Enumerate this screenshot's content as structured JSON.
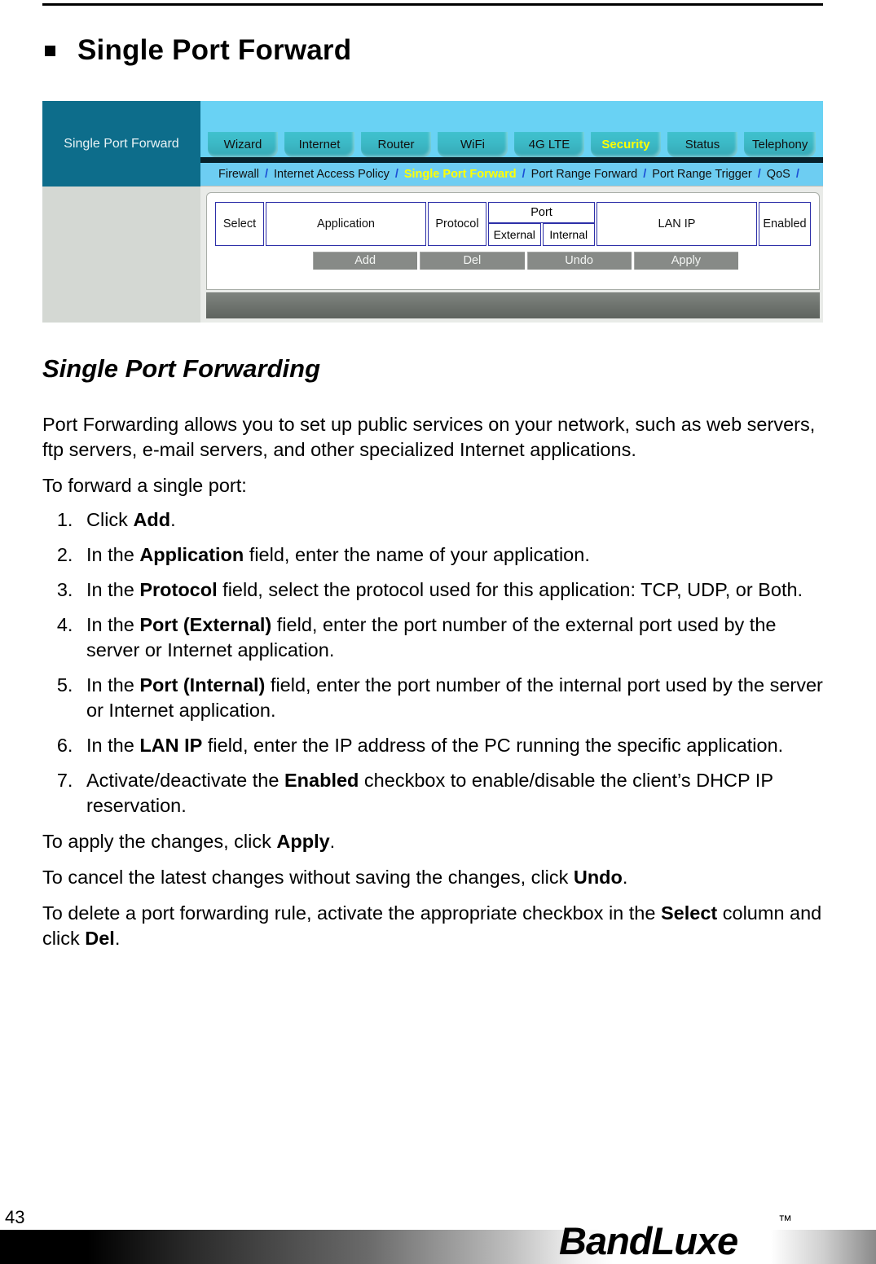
{
  "document": {
    "page_number": "43",
    "heading": "Single Port Forward",
    "section_heading": "Single Port Forwarding"
  },
  "figure": {
    "sidebar_title": "Single Port Forward",
    "tabs": [
      {
        "label": "Wizard",
        "active": false
      },
      {
        "label": "Internet",
        "active": false
      },
      {
        "label": "Router",
        "active": false
      },
      {
        "label": "WiFi",
        "active": false
      },
      {
        "label": "4G LTE",
        "active": false
      },
      {
        "label": "Security",
        "active": true
      },
      {
        "label": "Status",
        "active": false
      },
      {
        "label": "Telephony",
        "active": false
      }
    ],
    "subnav": [
      {
        "label": "Firewall",
        "active": false
      },
      {
        "label": "Internet Access Policy",
        "active": false
      },
      {
        "label": "Single Port Forward",
        "active": true
      },
      {
        "label": "Port Range Forward",
        "active": false
      },
      {
        "label": "Port Range Trigger",
        "active": false
      },
      {
        "label": "QoS",
        "active": false
      }
    ],
    "subnav_separator": "/",
    "table_headers": {
      "select": "Select",
      "application": "Application",
      "protocol": "Protocol",
      "port": "Port",
      "port_external": "External",
      "port_internal": "Internal",
      "lan_ip": "LAN IP",
      "enabled": "Enabled"
    },
    "buttons": [
      {
        "label": "Add"
      },
      {
        "label": "Del"
      },
      {
        "label": "Undo"
      },
      {
        "label": "Apply"
      }
    ],
    "colors": {
      "sidebar": "#0d6d8b",
      "topbar": "#69d2f4",
      "tab": "#3cb9c6",
      "tab_active_text": "#ffff00",
      "subnav_bg": "#6dcdf2",
      "subnav_separator": "#1b4fd6",
      "table_border": "#2d2fa8",
      "button": "#878a87"
    }
  },
  "body": {
    "intro": "Port Forwarding allows you to set up public services on your network, such as web servers, ftp servers, e-mail servers, and other specialized Internet applications.",
    "lead_in": "To forward a single port:",
    "steps": [
      {
        "pre": "Click ",
        "bold": "Add",
        "post": "."
      },
      {
        "pre": "In the ",
        "bold": "Application",
        "post": " field, enter the name of your application."
      },
      {
        "pre": "In the ",
        "bold": "Protocol",
        "post": " field, select the protocol used for this application: TCP, UDP, or Both."
      },
      {
        "pre": "In the ",
        "bold": "Port (External)",
        "post": " field, enter the port number of the external port used by the server or Internet application."
      },
      {
        "pre": "In the ",
        "bold": "Port (Internal)",
        "post": " field, enter the port number of the internal port used by the server or Internet application."
      },
      {
        "pre": "In the ",
        "bold": "LAN IP",
        "post": " field, enter the IP address of the PC running the specific application."
      },
      {
        "pre": "Activate/deactivate the ",
        "bold": "Enabled",
        "post": " checkbox to enable/disable the client’s DHCP IP reservation."
      }
    ],
    "closing": [
      {
        "pre": "To apply the changes, click ",
        "bold": "Apply",
        "post": "."
      },
      {
        "pre": "To cancel the latest changes without saving the changes, click ",
        "bold": "Undo",
        "post": "."
      },
      {
        "pre": "To delete a port forwarding rule, activate the appropriate checkbox in the ",
        "bold": "Select",
        "mid": " column and click ",
        "bold2": "Del",
        "post": "."
      }
    ]
  },
  "footer": {
    "logo": "BandLuxe",
    "trademark": "™"
  }
}
